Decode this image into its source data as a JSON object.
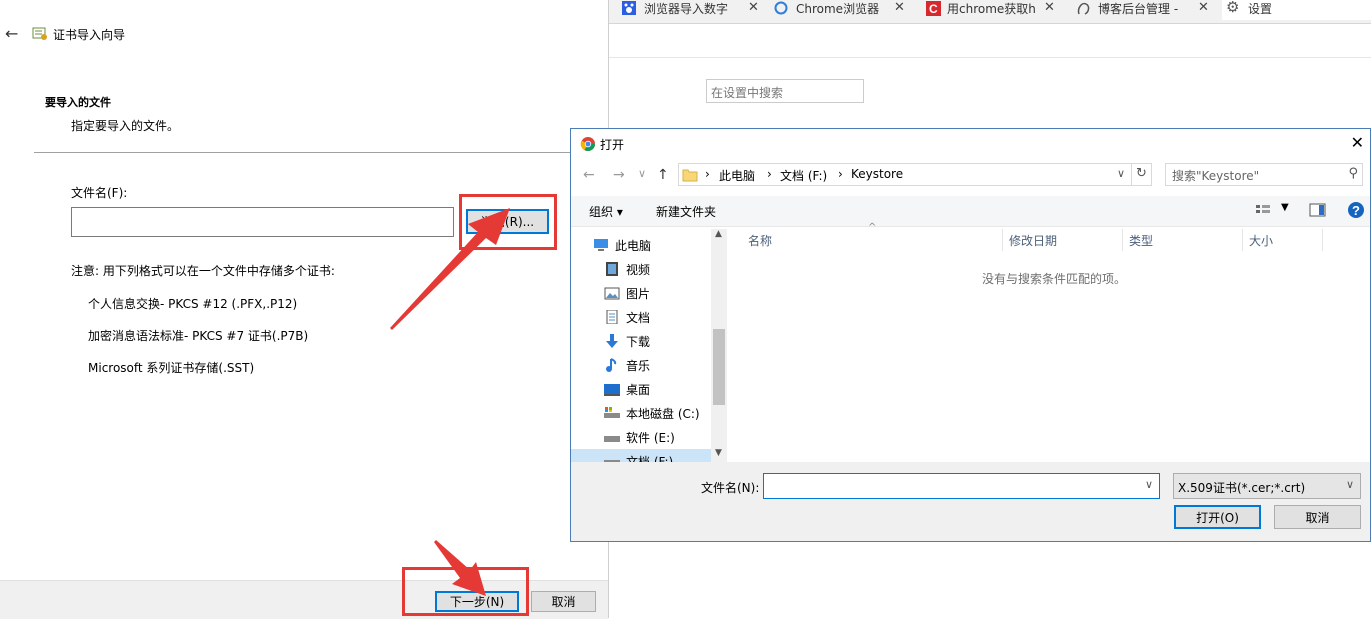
{
  "chrome": {
    "tabs": [
      {
        "label": "浏览器导入数字"
      },
      {
        "label": "Chrome浏览器"
      },
      {
        "label": "用chrome获取h"
      },
      {
        "label": "博客后台管理 - "
      },
      {
        "label": "设置"
      }
    ],
    "settings_search_placeholder": "在设置中搜索",
    "close_glyph": "✕"
  },
  "wizard": {
    "title": "证书导入向导",
    "section_title": "要导入的文件",
    "section_subtitle": "指定要导入的文件。",
    "filename_label": "文件名(F):",
    "filename_value": "",
    "browse_button": "浏览(R)...",
    "note": "注意: 用下列格式可以在一个文件中存储多个证书:",
    "formats": [
      "个人信息交换- PKCS #12 (.PFX,.P12)",
      "加密消息语法标准- PKCS #7 证书(.P7B)",
      "Microsoft 系列证书存储(.SST)"
    ],
    "next_button": "下一步(N)",
    "cancel_button": "取消"
  },
  "dialog": {
    "title": "打开",
    "breadcrumb": [
      "此电脑",
      "文档 (F:)",
      "Keystore"
    ],
    "search_placeholder": "搜索\"Keystore\"",
    "organize": "组织 ▾",
    "new_folder": "新建文件夹",
    "tree": [
      {
        "label": "此电脑",
        "icon": "computer-icon"
      },
      {
        "label": "视频",
        "icon": "video-icon"
      },
      {
        "label": "图片",
        "icon": "picture-icon"
      },
      {
        "label": "文档",
        "icon": "document-icon"
      },
      {
        "label": "下载",
        "icon": "download-icon"
      },
      {
        "label": "音乐",
        "icon": "music-icon"
      },
      {
        "label": "桌面",
        "icon": "desktop-icon"
      },
      {
        "label": "本地磁盘 (C:)",
        "icon": "drive-icon"
      },
      {
        "label": "软件 (E:)",
        "icon": "drive-icon"
      },
      {
        "label": "文档 (F:)",
        "icon": "drive-icon"
      }
    ],
    "columns": [
      "名称",
      "修改日期",
      "类型",
      "大小"
    ],
    "empty_message": "没有与搜索条件匹配的项。",
    "filename_label": "文件名(N):",
    "filename_value": "",
    "filter": "X.509证书(*.cer;*.crt)",
    "open_button": "打开(O)",
    "cancel_button": "取消"
  },
  "colors": {
    "annotation": "#e53935",
    "accent": "#0078d7",
    "help": "#1565c0"
  }
}
